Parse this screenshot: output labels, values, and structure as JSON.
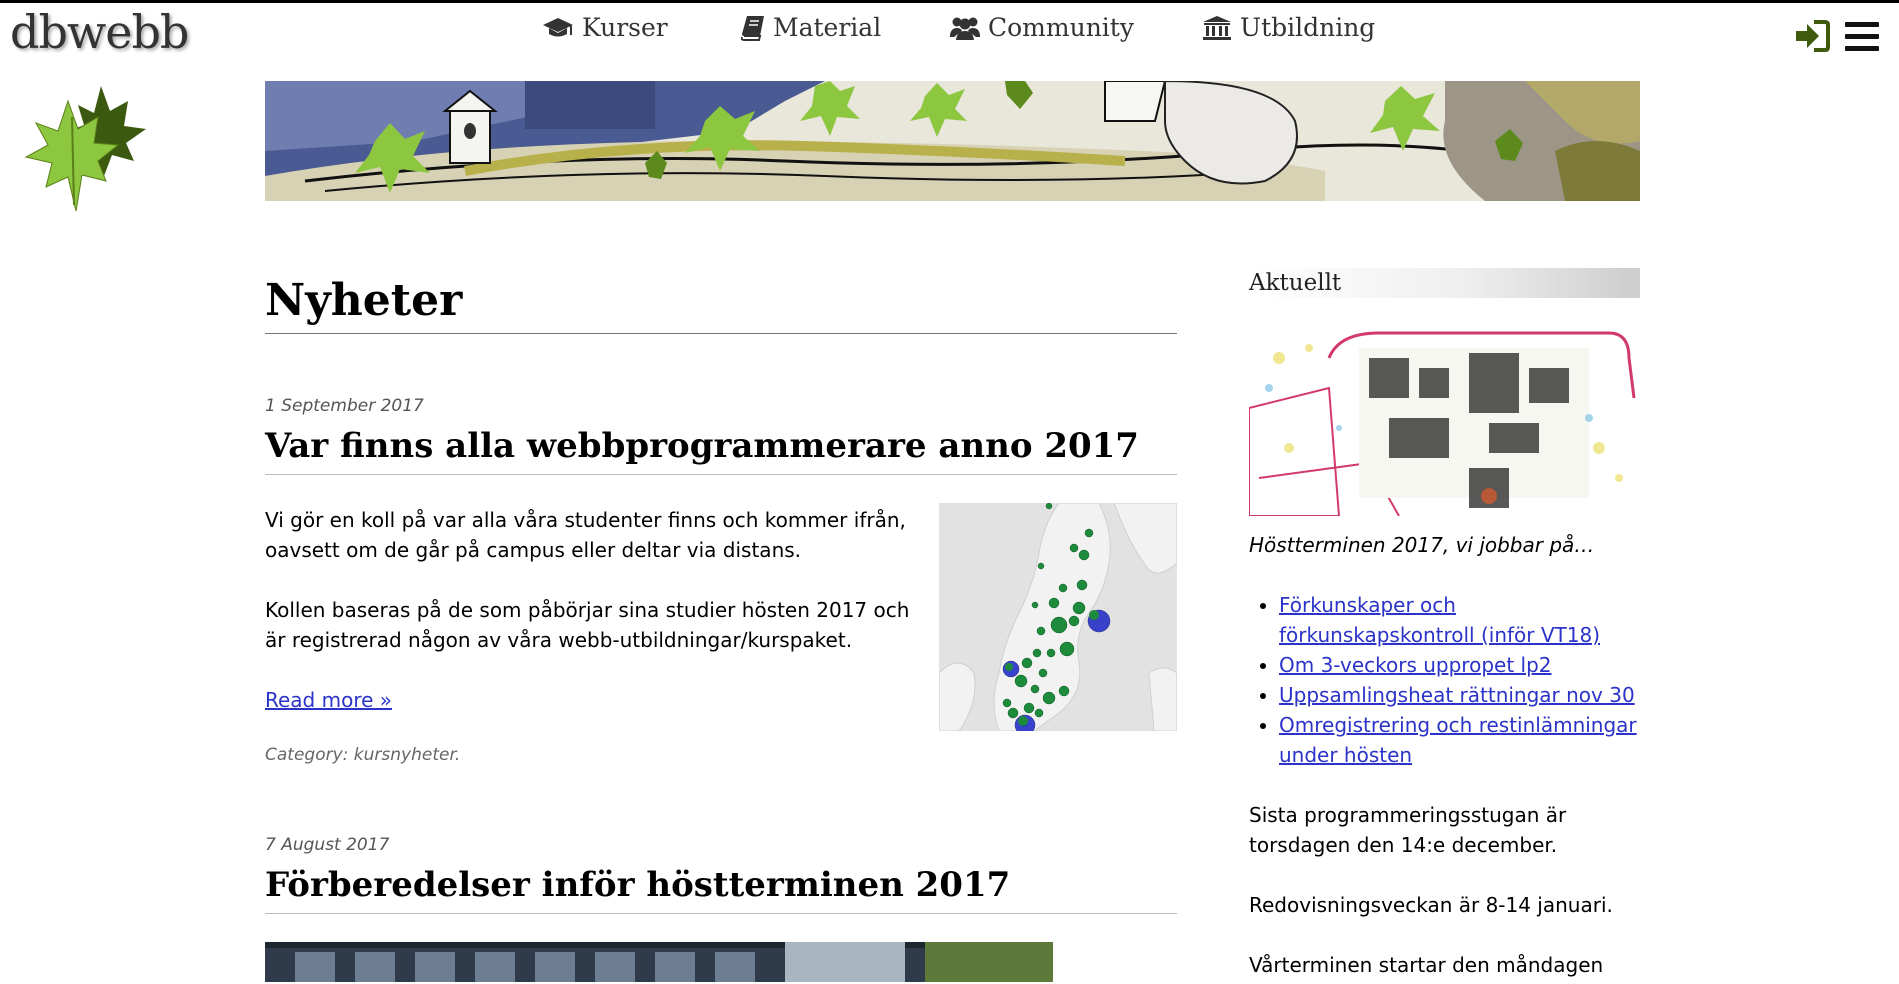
{
  "header": {
    "logo": "dbwebb",
    "nav": [
      {
        "label": "Kurser",
        "icon": "graduation-cap-icon"
      },
      {
        "label": "Material",
        "icon": "book-icon"
      },
      {
        "label": "Community",
        "icon": "users-icon"
      },
      {
        "label": "Utbildning",
        "icon": "university-icon"
      }
    ],
    "login_icon": "sign-in-icon",
    "menu_icon": "hamburger-menu-icon"
  },
  "colors": {
    "link": "#2b33c8",
    "icon_green": "#3e5a0c",
    "leaf_green": "#8dc63f"
  },
  "main": {
    "title": "Nyheter",
    "articles": [
      {
        "date": "1 September 2017",
        "title": "Var finns alla webbprogrammerare anno 2017",
        "paragraphs": [
          "Vi gör en koll på var alla våra studenter finns och kommer ifrån, oavsett om de går på campus eller deltar via distans.",
          "Kollen baseras på de som påbörjar sina studier hösten 2017 och är registrerad någon av våra webb-utbildningar/kurspaket."
        ],
        "read_more": "Read more »",
        "category": "Category: kursnyheter."
      },
      {
        "date": "7 August 2017",
        "title": "Förberedelser inför höstterminen 2017"
      }
    ]
  },
  "sidebar": {
    "header": "Aktuellt",
    "caption": "Höstterminen 2017, vi jobbar på…",
    "links": [
      "Förkunskaper och förkunskapskontroll (inför VT18)",
      "Om 3-veckors uppropet lp2",
      "Uppsamlingsheat rättningar nov 30",
      "Omregistrering och restinlämningar under hösten"
    ],
    "paragraphs": [
      "Sista programmeringsstugan är torsdagen den 14:e december.",
      "Redovisningsveckan är 8-14 januari.",
      "Vårterminen startar den måndagen"
    ]
  }
}
